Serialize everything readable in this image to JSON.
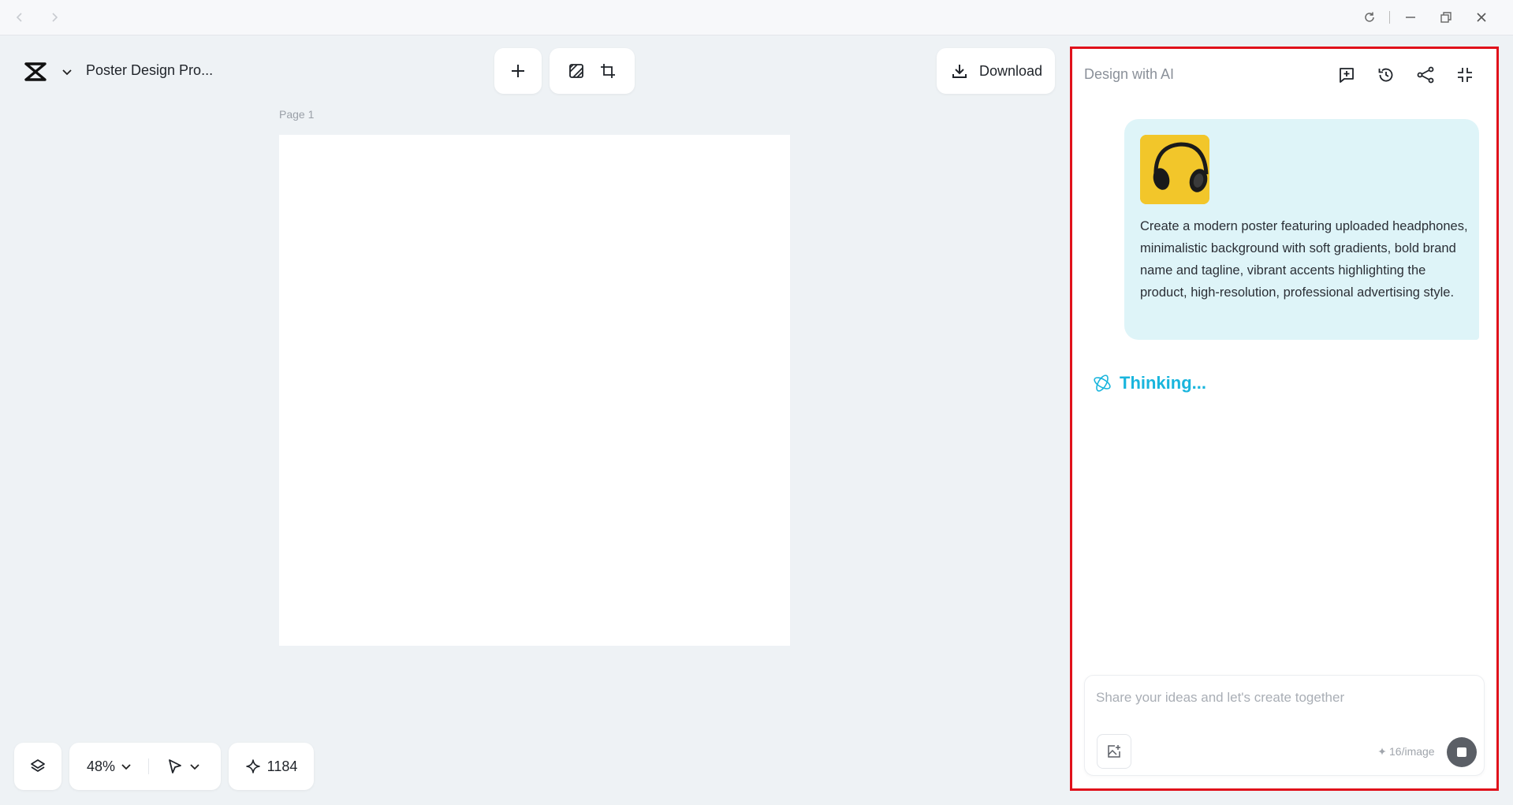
{
  "brand": {
    "project_name": "Poster Design Pro..."
  },
  "toolbar": {
    "download_label": "Download"
  },
  "canvas": {
    "page_label": "Page 1"
  },
  "bottom": {
    "zoom": "48%",
    "credits": "1184"
  },
  "ai_panel": {
    "title": "Design with AI",
    "message": "Create a modern poster featuring uploaded headphones, minimalistic background with soft gradients, bold brand name and tagline, vibrant accents highlighting the product, high-resolution, professional advertising style.",
    "status": "Thinking...",
    "input_placeholder": "Share your ideas and let's create together",
    "cost": "16/image"
  },
  "colors": {
    "accent": "#19b5dd",
    "highlight_border": "#e0111b",
    "bubble": "#def4f8"
  }
}
